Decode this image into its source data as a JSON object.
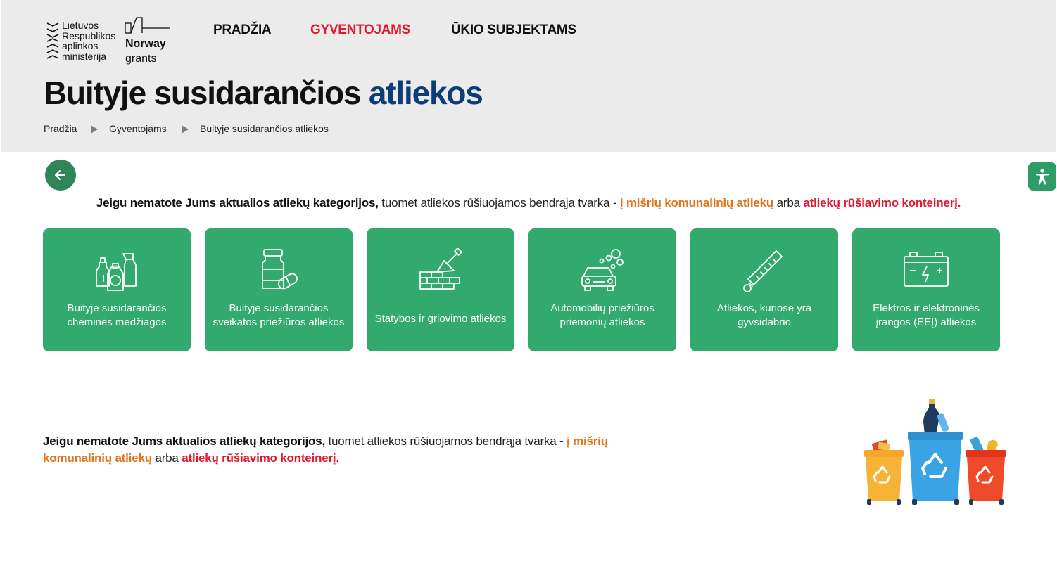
{
  "logos": {
    "ministry_lines": [
      "Lietuvos",
      "Respublikos",
      "aplinkos",
      "ministerija"
    ],
    "norway_bold": "Norway",
    "norway_light": "grants"
  },
  "nav": {
    "items": [
      {
        "label": "PRADŽIA",
        "active": false
      },
      {
        "label": "GYVENTOJAMS",
        "active": true
      },
      {
        "label": "ŪKIO SUBJEKTAMS",
        "active": false
      }
    ],
    "active_color": "#e4182c"
  },
  "page": {
    "title_main": "Buityje susidarančios",
    "title_accent": "atliekos",
    "accent_color": "#0c3d7a"
  },
  "breadcrumb": [
    "Pradžia",
    "Gyventojams",
    "Buityje susidarančios atliekos"
  ],
  "buttons": {
    "back_icon": "arrow-left-icon",
    "accessibility_icon": "accessibility-person-icon"
  },
  "notice": {
    "bold": "Jeigu nematote Jums aktualios atliekų kategorijos,",
    "text1": "tuomet atliekos rūšiuojamos bendrąja tvarka -",
    "orange": "į mišrių komunalinių atliekų",
    "orange_part1": "į mišrių",
    "orange_part2": "komunalinių atliekų",
    "text2": "arba",
    "red": "atliekų rūšiavimo konteinerį."
  },
  "colors": {
    "card_green": "#33aa6d",
    "back_green": "#2e8557",
    "orange": "#e2741b",
    "red": "#e4182c",
    "header_bg": "#ebebeb"
  },
  "cards": [
    {
      "icon": "cleaning-bottles-icon",
      "lines": [
        "Buityje susidarančios",
        "cheminės medžiagos"
      ]
    },
    {
      "icon": "medicine-jar-pills-icon",
      "lines": [
        "Buityje susidarančios",
        "sveikatos priežiūros atliekos"
      ]
    },
    {
      "icon": "brick-wall-trowel-icon",
      "lines": [
        "Statybos ir griovimo atliekos"
      ]
    },
    {
      "icon": "car-wash-icon",
      "lines": [
        "Automobilių priežiūros",
        "priemonių atliekos"
      ]
    },
    {
      "icon": "thermometer-icon",
      "lines": [
        "Atliekos, kuriose yra",
        "gyvsidabrio"
      ]
    },
    {
      "icon": "battery-icon",
      "lines": [
        "Elektros ir elektroninės",
        "įrangos (EEĮ) atliekos"
      ]
    }
  ],
  "illustration": {
    "icon": "recycling-bins-illustration"
  }
}
